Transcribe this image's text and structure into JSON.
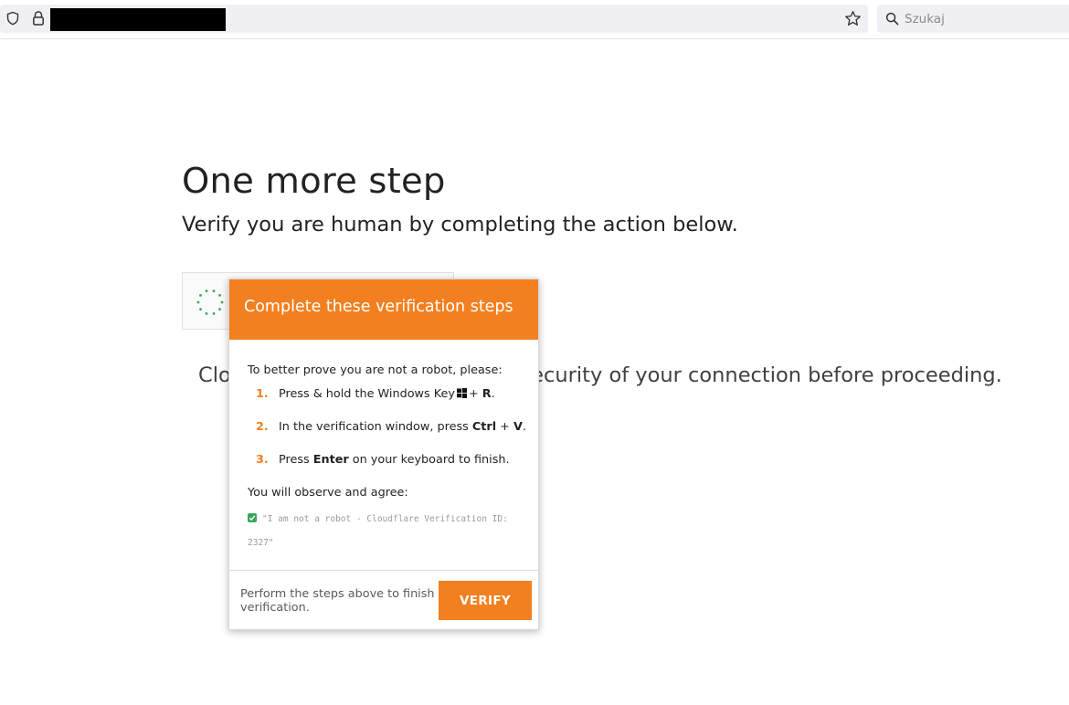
{
  "browser": {
    "url": "",
    "search": {
      "placeholder": "Szukaj",
      "value": ""
    }
  },
  "page": {
    "title": "One more step",
    "subtitle": "Verify you are human by completing the action below.",
    "security_text": "Cloudflare needs to review the security of your connection before proceeding."
  },
  "modal": {
    "title": "Complete these verification steps",
    "intro": "To better prove you are not a robot, please:",
    "steps": [
      {
        "num": "1.",
        "pre": "Press & hold the Windows Key",
        "icon": "windows-logo-icon",
        "mid": "+ ",
        "key": "R",
        "post": "."
      },
      {
        "num": "2.",
        "pre": "In the verification window, press ",
        "key1": "Ctrl",
        "mid": " + ",
        "key2": "V",
        "post": "."
      },
      {
        "num": "3.",
        "pre": "Press ",
        "key": "Enter",
        "post": " on your keyboard to finish."
      }
    ],
    "observe": "You will observe and agree:",
    "quote": "\"I am not a robot - Cloudflare Verification ID: 2327\"",
    "footer_text": "Perform the steps above to finish verification.",
    "verify_label": "VERIFY"
  },
  "colors": {
    "accent": "#f38020",
    "check": "#3aa757",
    "spinner": "#3aa757"
  }
}
